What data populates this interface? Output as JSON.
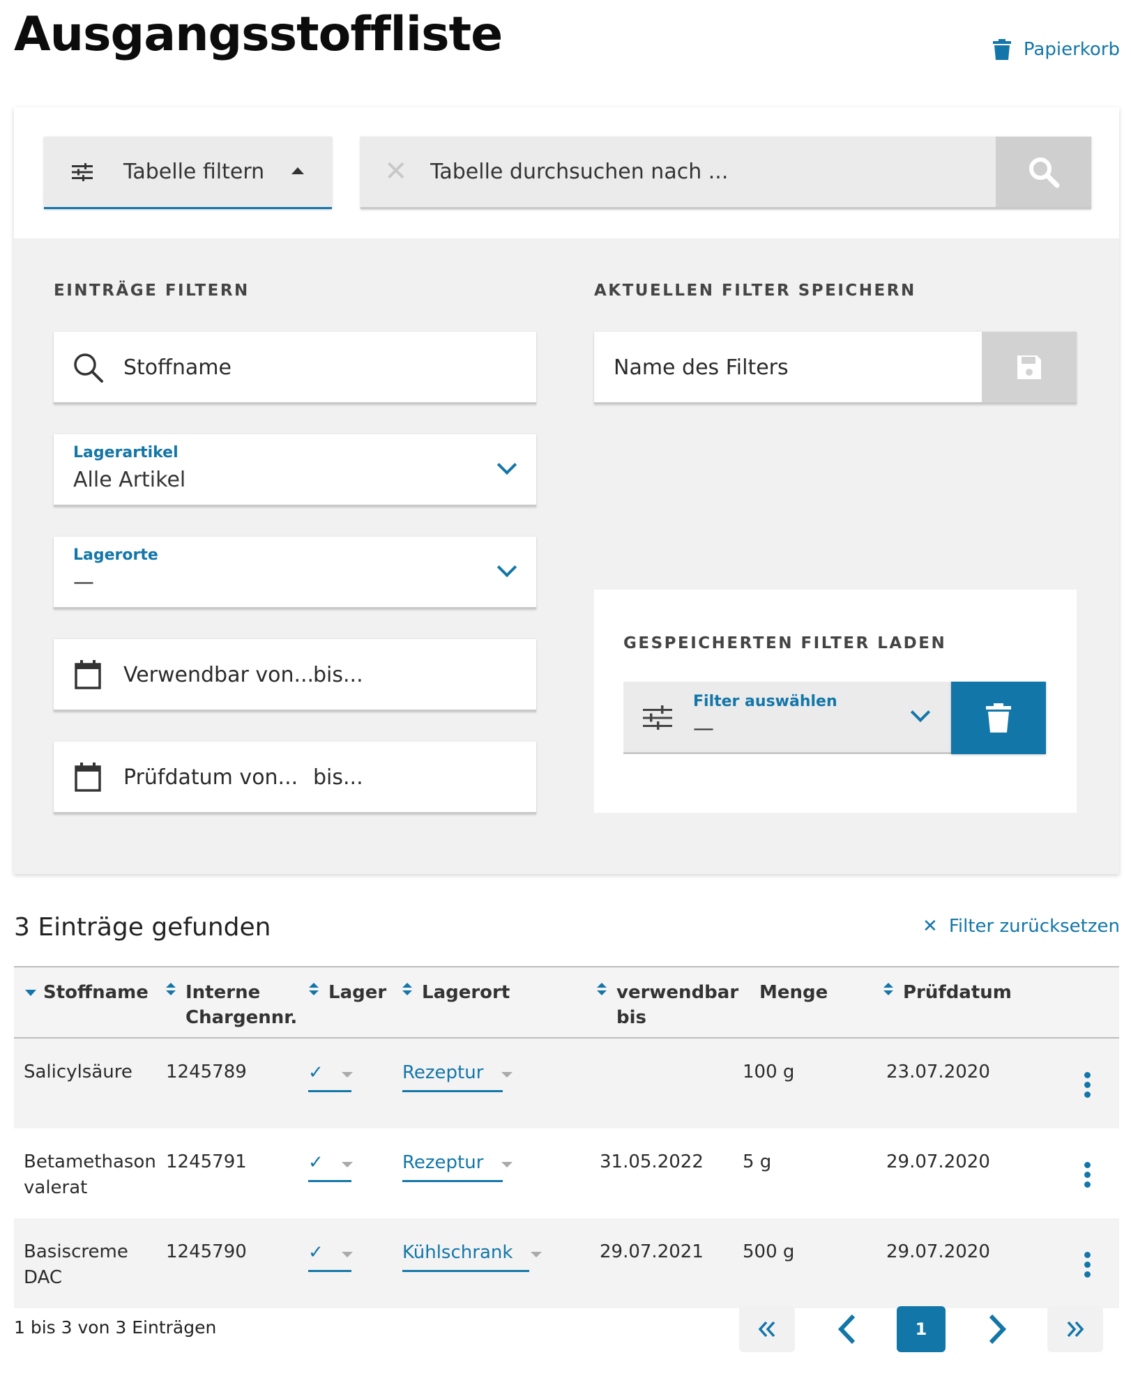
{
  "header": {
    "title": "Ausgangsstoffliste",
    "trash_label": "Papierkorb"
  },
  "toolbar": {
    "filter_toggle_label": "Tabelle filtern",
    "search_placeholder": "Tabelle durchsuchen nach ..."
  },
  "filter_entries": {
    "heading": "EINTRÄGE FILTERN",
    "substance_placeholder": "Stoffname",
    "stock_item": {
      "label": "Lagerartikel",
      "value": "Alle Artikel"
    },
    "locations": {
      "label": "Lagerorte",
      "value": "—"
    },
    "usable": {
      "from": "Verwendbar von...",
      "to": "bis..."
    },
    "tested": {
      "from": "Prüfdatum von...",
      "to": "bis..."
    }
  },
  "save_filter": {
    "heading": "AKTUELLEN FILTER SPEICHERN",
    "name_placeholder": "Name des Filters"
  },
  "load_filter": {
    "heading": "GESPEICHERTEN FILTER LADEN",
    "select_label": "Filter auswählen",
    "select_value": "—"
  },
  "results": {
    "count_text": "3 Einträge gefunden",
    "reset_label": "Filter zurücksetzen"
  },
  "table": {
    "columns": {
      "name": "Stoffname",
      "batch_1": "Interne",
      "batch_2": "Chargennr.",
      "stock": "Lager",
      "location": "Lagerort",
      "usable_1": "verwendbar",
      "usable_2": "bis",
      "amount": "Menge",
      "tested": "Prüfdatum"
    },
    "rows": [
      {
        "name_1": "Salicylsäure",
        "name_2": "",
        "batch": "1245789",
        "stock": "✓",
        "location": "Rezeptur",
        "usable": "",
        "amount": "100 g",
        "tested": "23.07.2020"
      },
      {
        "name_1": "Betamethason",
        "name_2": "valerat",
        "batch": "1245791",
        "stock": "✓",
        "location": "Rezeptur",
        "usable": "31.05.2022",
        "amount": "5 g",
        "tested": "29.07.2020"
      },
      {
        "name_1": "Basiscreme",
        "name_2": "DAC",
        "batch": "1245790",
        "stock": "✓",
        "location": "Kühlschrank",
        "usable": "29.07.2021",
        "amount": "500 g",
        "tested": "29.07.2020"
      }
    ]
  },
  "pagination": {
    "info": "1 bis 3 von 3 Einträgen",
    "current_page": "1"
  },
  "colors": {
    "accent": "#1376a8",
    "panel": "#f1f1f1"
  }
}
